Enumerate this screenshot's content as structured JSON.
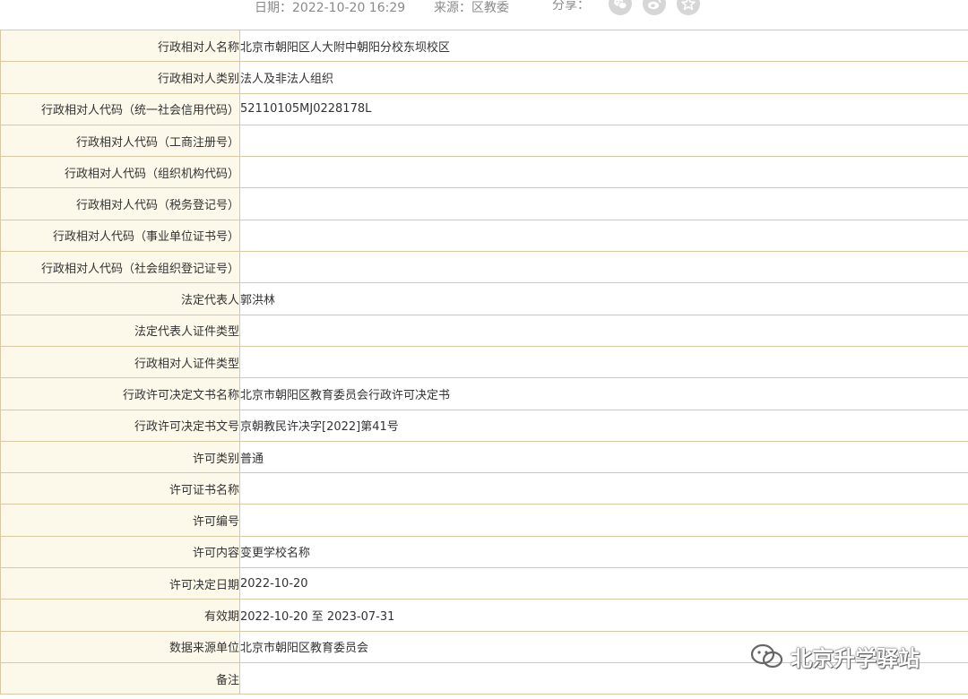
{
  "meta": {
    "date_label": "日期：2022-10-20 16:29",
    "source_label": "来源：区教委",
    "share_label": "分享："
  },
  "share": {
    "icons": [
      "wechat-icon",
      "weibo-icon",
      "favorite-star-icon"
    ]
  },
  "rows": [
    {
      "label": "行政相对人名称",
      "value": "北京市朝阳区人大附中朝阳分校东坝校区"
    },
    {
      "label": "行政相对人类别",
      "value": "法人及非法人组织"
    },
    {
      "label": "行政相对人代码（统一社会信用代码）",
      "value": "52110105MJ0228178L"
    },
    {
      "label": "行政相对人代码（工商注册号）",
      "value": ""
    },
    {
      "label": "行政相对人代码（组织机构代码）",
      "value": ""
    },
    {
      "label": "行政相对人代码（税务登记号）",
      "value": ""
    },
    {
      "label": "行政相对人代码（事业单位证书号）",
      "value": ""
    },
    {
      "label": "行政相对人代码（社会组织登记证号）",
      "value": ""
    },
    {
      "label": "法定代表人",
      "value": "郭洪林"
    },
    {
      "label": "法定代表人证件类型",
      "value": ""
    },
    {
      "label": "行政相对人证件类型",
      "value": ""
    },
    {
      "label": "行政许可决定文书名称",
      "value": "北京市朝阳区教育委员会行政许可决定书"
    },
    {
      "label": "行政许可决定书文号",
      "value": "京朝教民许决字[2022]第41号"
    },
    {
      "label": "许可类别",
      "value": "普通"
    },
    {
      "label": "许可证书名称",
      "value": ""
    },
    {
      "label": "许可编号",
      "value": ""
    },
    {
      "label": "许可内容",
      "value": "变更学校名称"
    },
    {
      "label": "许可决定日期",
      "value": "2022-10-20"
    },
    {
      "label": "有效期",
      "value": "2022-10-20 至 2023-07-31"
    },
    {
      "label": "数据来源单位",
      "value": "北京市朝阳区教育委员会"
    },
    {
      "label": "备注",
      "value": ""
    }
  ],
  "watermark": {
    "text": "北京升学驿站",
    "icon": "wechat-logo-icon"
  },
  "colors": {
    "label_bg": "#fcf8ea",
    "border": "#d9c9a3",
    "meta_text": "#8a8a8a",
    "share_icon_bg": "#d6d6d6"
  }
}
